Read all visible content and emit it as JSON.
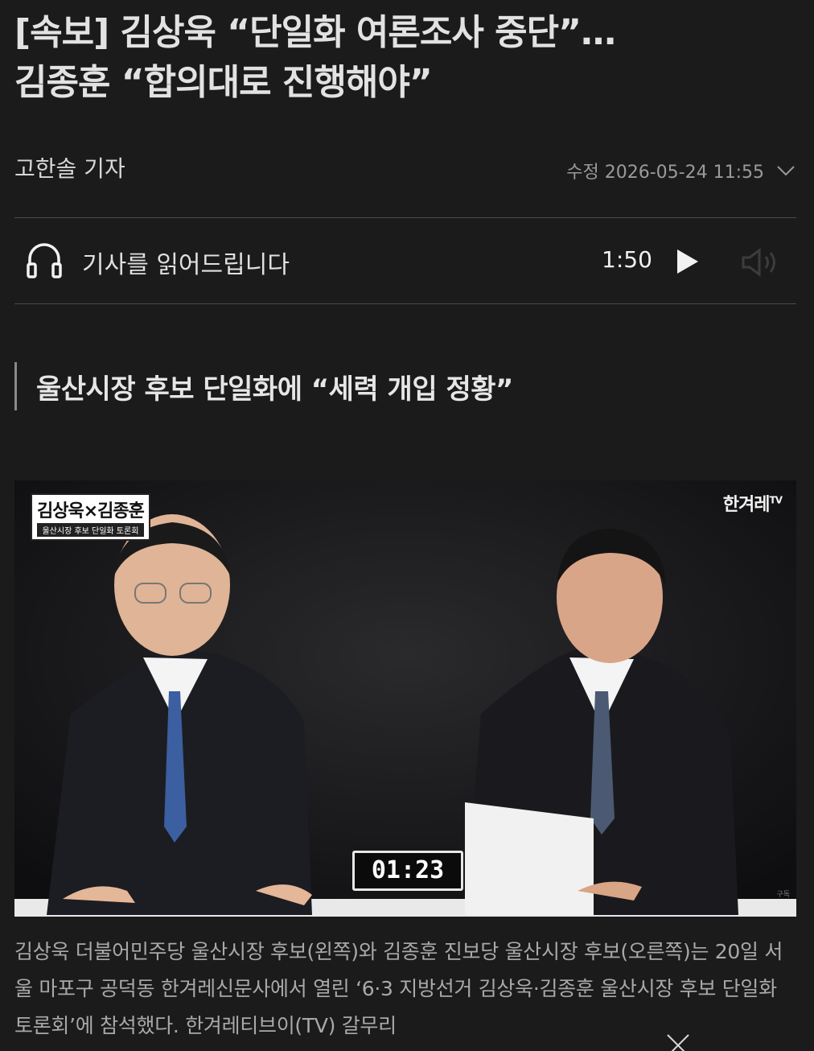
{
  "article": {
    "headline_line1": "[속보] 김상욱 “단일화 여론조사 중단”…",
    "headline_line2": "김종훈 “합의대로 진행해야”",
    "reporter": "고한솔 기자",
    "modified": "수정 2026-05-24 11:55"
  },
  "tts": {
    "label": "기사를 읽어드립니다",
    "duration": "1:50",
    "icons": [
      "headphone-icon",
      "play-icon",
      "volume-icon"
    ]
  },
  "subhead": "울산시장 후보 단일화에 “세력 개입 정황”",
  "photo": {
    "overlay_title": "김상욱×김종훈",
    "overlay_subtitle": "울산시장 후보 단일화 토론회",
    "brand": "한겨레",
    "brand_suffix": "TV",
    "timer": "01:23",
    "watermark": "구독"
  },
  "caption": "김상욱 더불어민주당 울산시장 후보(왼쪽)와 김종훈 진보당 울산시장 후보(오른쪽)는 20일 서울 마포구 공덕동 한겨레신문사에서 열린 ‘6·3 지방선거 김상욱·김종훈 울산시장 후보 단일화 토론회’에 참석했다. 한겨레티브이(TV) 갈무리",
  "colors": {
    "background": "#1b1b1c",
    "text": "#e2e2e2",
    "muted": "#9a9a9a",
    "divider": "#4a4a4c"
  }
}
